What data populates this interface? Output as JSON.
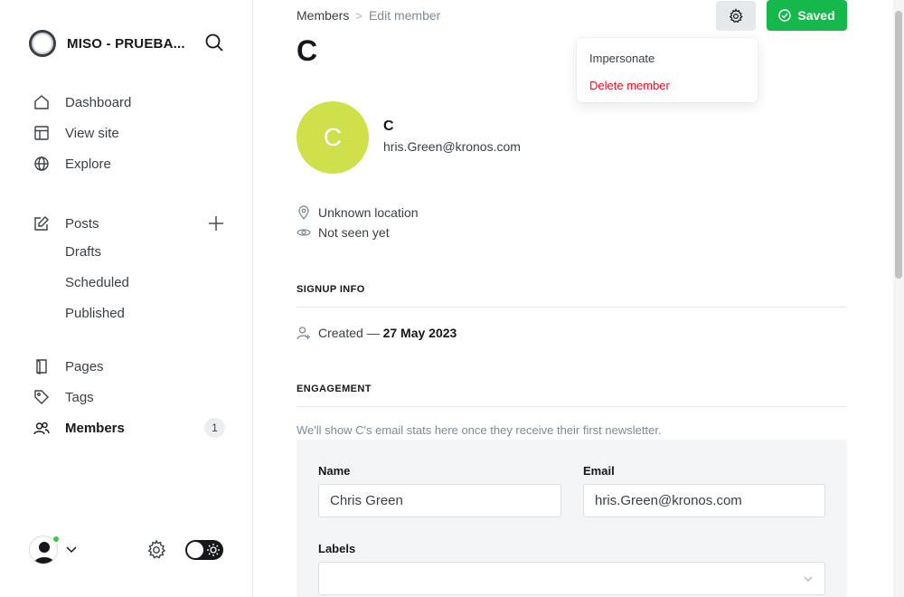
{
  "brand": {
    "name": "MISO - PRUEBA...",
    "logo_icon": "ghost-logo-ring"
  },
  "nav": {
    "dashboard": "Dashboard",
    "view_site": "View site",
    "explore": "Explore",
    "posts": "Posts",
    "drafts": "Drafts",
    "scheduled": "Scheduled",
    "published": "Published",
    "pages": "Pages",
    "tags": "Tags",
    "members": "Members",
    "members_count": "1"
  },
  "breadcrumb": {
    "parent": "Members",
    "separator": ">",
    "current": "Edit member"
  },
  "page_title": "C",
  "actions": {
    "saved_label": "Saved",
    "accent": "#14b84b"
  },
  "dropdown": {
    "impersonate": "Impersonate",
    "delete": "Delete member",
    "delete_color": "#f50b23"
  },
  "member": {
    "initial": "C",
    "name": "C",
    "email": "hris.Green@kronos.com",
    "avatar_color": "#cfe04b",
    "location": "Unknown location",
    "seen": "Not seen yet"
  },
  "signup": {
    "heading": "SIGNUP INFO",
    "created_prefix": "Created —",
    "created_date": "27 May 2023"
  },
  "engagement": {
    "heading": "ENGAGEMENT",
    "note": "We'll show C's email stats here once they receive their first newsletter."
  },
  "form": {
    "name_label": "Name",
    "name_value": "Chris Green",
    "email_label": "Email",
    "email_value": "hris.Green@kronos.com",
    "labels_label": "Labels"
  }
}
